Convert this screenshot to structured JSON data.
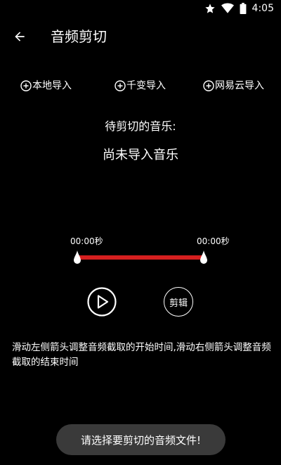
{
  "status_bar": {
    "time": "4:05",
    "icons": [
      "star-icon",
      "wifi-icon",
      "battery-icon"
    ]
  },
  "app_bar": {
    "back_icon": "arrow-left-icon",
    "title": "音频剪切"
  },
  "import_options": [
    {
      "label": "本地导入",
      "icon": "plus-circle-icon"
    },
    {
      "label": "千变导入",
      "icon": "plus-circle-icon"
    },
    {
      "label": "网易云导入",
      "icon": "plus-circle-icon"
    }
  ],
  "pending_label": "待剪切的音乐:",
  "current_track": "尚未导入音乐",
  "range": {
    "start_time": "00:00秒",
    "end_time": "00:00秒",
    "track_color": "#d51f1f"
  },
  "controls": {
    "play_icon": "play-icon",
    "cut_label": "剪辑"
  },
  "hint": "滑动左侧箭头调整音频截取的开始时间,滑动右侧箭头调整音频截取的结束时间",
  "toast": "请选择要剪切的音频文件!"
}
